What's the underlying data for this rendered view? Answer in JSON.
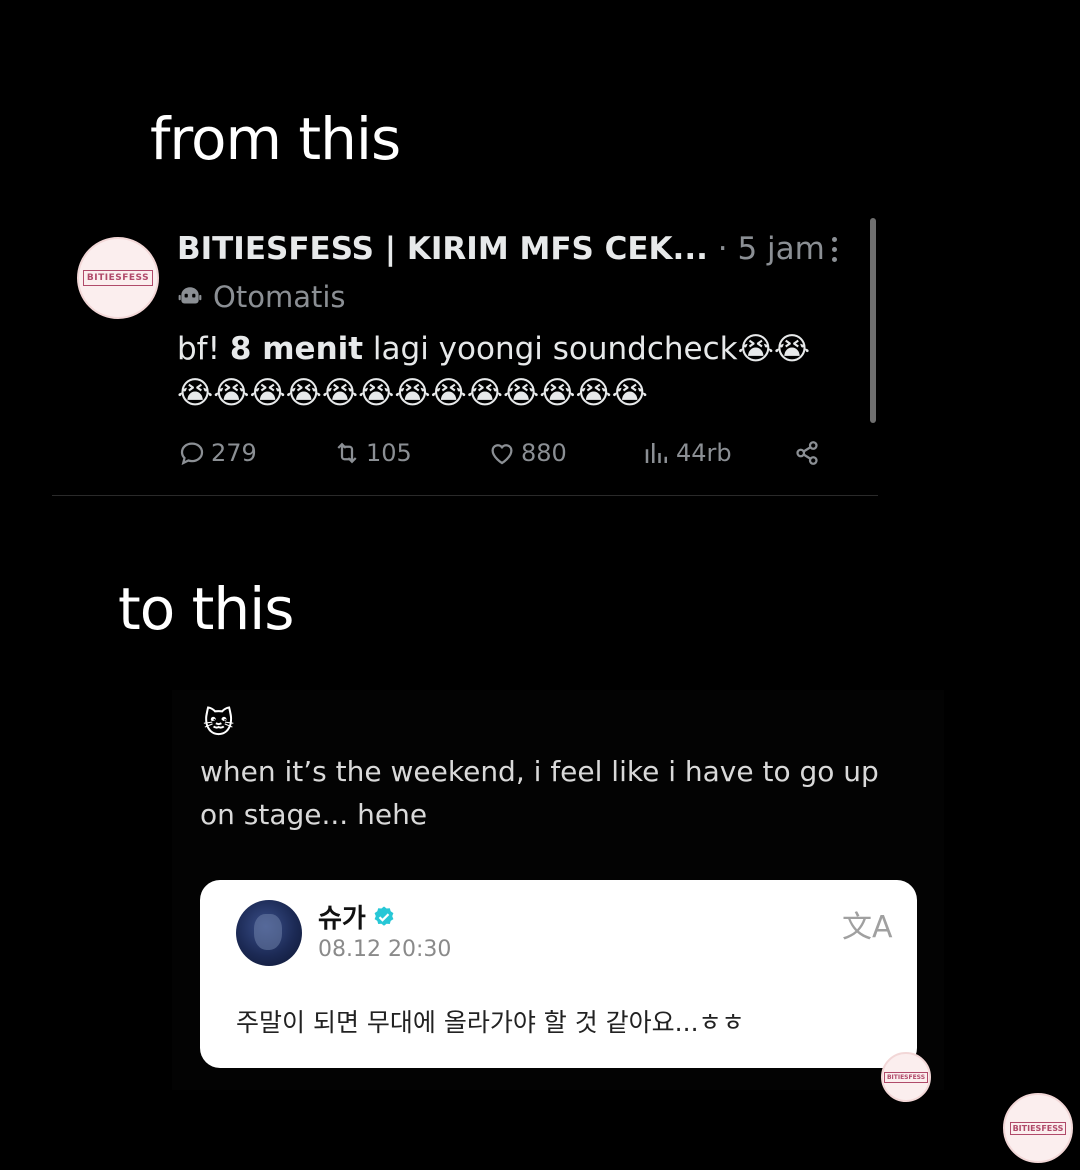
{
  "captions": {
    "from": "from this",
    "to": "to this"
  },
  "tweet": {
    "avatar_logo": "BITIESFESS",
    "display_name": "BITIESFESS | KIRIM MFS CEK...",
    "time": "· 5 jam",
    "automated_label": "Otomatis",
    "text_prefix": "bf! ",
    "text_bold": "8 menit",
    "text_rest": " lagi yoongi soundcheck",
    "emoji_line1": "😭😭",
    "emoji_line2": "😭😭😭😭😭😭😭😭😭😭😭😭😭",
    "stats": {
      "replies": "279",
      "retweets": "105",
      "likes": "880",
      "views": "44rb"
    },
    "icons": [
      "more-icon",
      "bot-icon",
      "reply-icon",
      "retweet-icon",
      "like-icon",
      "views-icon",
      "share-icon"
    ]
  },
  "translation": {
    "emoji": "🐱",
    "text": "when it’s the weekend, i feel like i have to go up on stage... hehe"
  },
  "weverse_post": {
    "name": "슈가",
    "date": "08.12 20:30",
    "translate_icon": "文A",
    "text": "주말이 되면 무대에 올라가야 할 것 같아요...ㅎㅎ",
    "verified_color": "#27c7d6"
  },
  "watermark": {
    "logo": "BITIESFESS"
  }
}
